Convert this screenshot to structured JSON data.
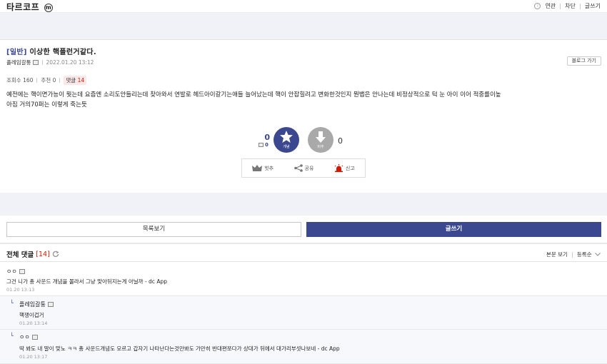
{
  "gallery": {
    "title": "타르코프",
    "badge": "m"
  },
  "top_actions": {
    "info": "ⓘ",
    "related": "연관",
    "block": "차단",
    "write": "글쓰기"
  },
  "post": {
    "category": "[일반]",
    "title": "이상한 핵플런거같다.",
    "author": "플레임갈퉁",
    "date": "2022.01.20 13:12",
    "blog_button": "블로그 가기",
    "views": "조회수 160",
    "recommend": "추천 0",
    "comments_label": "댓글",
    "comments_count": "14",
    "body_line1": "예전에는 핵이면가능이 뭣는데 요즘엔 소리도안들리는데 찾아와서 연발로 헤드아이갈기는애들 늘어났는데 핵이 안잡힐려고 변화한것인지 뭔뱁은 안나는데 비정상적으로 턱 눈 아이 이어 적중률이높",
    "body_line2": "아짐 거의70퍼는 이렇게 죽는듯"
  },
  "vote": {
    "up_count": "0",
    "up_fixed_count": "0",
    "up_label": "개념",
    "down_label": "비추",
    "down_count": "0"
  },
  "actions": {
    "best": "힛추",
    "share": "공유",
    "report": "신고"
  },
  "buttons": {
    "list": "목록보기",
    "write": "글쓰기"
  },
  "comments_header": {
    "title": "전체 댓글",
    "count": "[14]",
    "view_body": "본문 보기",
    "sort": "등록순"
  },
  "comments": [
    {
      "name": "ㅇㅇ",
      "text": "그건 니가 총 사운드 개념을 몰라서 그냥 맞아뒤지는게 아닐까 - dc App",
      "date": "01.20 13:13"
    },
    {
      "name": "플레임갈퉁",
      "text": "핵쟁이겁거",
      "date": "01.20 13:14"
    },
    {
      "name": "ㅇㅇ",
      "text": "딱 봐도 내 말이 맞노 ㅋㅋ 총 사운드개념도 모르고 갑자기 나타난다는것만봐도 가만히 반대편쪼다가 상대가 뒤에서 대가리부셧나보네 - dc App",
      "date": "01.20 13:17"
    }
  ],
  "colors": {
    "accent": "#3b4890",
    "red": "#d31900",
    "band": "#f1f2f7"
  }
}
